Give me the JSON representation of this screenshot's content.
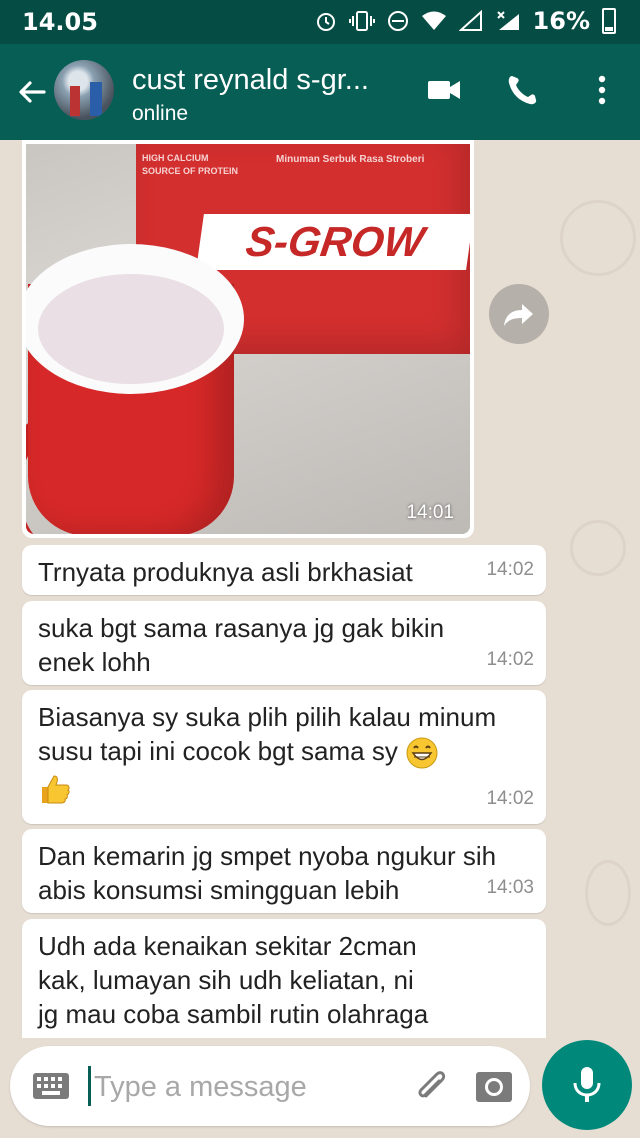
{
  "status_bar": {
    "time": "14.05",
    "battery": "16%",
    "icons": [
      "alarm-icon",
      "vibrate-icon",
      "do-not-disturb-icon",
      "wifi-icon",
      "signal-icon",
      "signal-x-icon",
      "battery-icon"
    ]
  },
  "header": {
    "contact_name": "cust reynald s-gr...",
    "status": "online",
    "icons": [
      "back-arrow-icon",
      "video-call-icon",
      "phone-icon",
      "more-vert-icon"
    ]
  },
  "messages": [
    {
      "type": "image",
      "time": "14:01",
      "image_text": {
        "badge": "HIGH CALCIUM\nSOURCE OF PROTEIN",
        "subtitle": "Minuman Serbuk Rasa Stroberi",
        "brand": "S-GROW"
      }
    },
    {
      "type": "text",
      "text": "Trnyata produknya asli brkhasiat",
      "time": "14:02"
    },
    {
      "type": "text",
      "text": "suka bgt sama rasanya jg gak bikin\nenek lohh",
      "time": "14:02"
    },
    {
      "type": "text",
      "text": "Biasanya sy suka plih pilih kalau minum\nsusu tapi ini cocok bgt sama sy",
      "emoji": [
        "grinning-face-icon",
        "thumbs-up-icon"
      ],
      "time": "14:02"
    },
    {
      "type": "text",
      "text": "Dan kemarin jg smpet nyoba ngukur sih\nabis konsumsi smingguan lebih",
      "time": "14:03"
    },
    {
      "type": "text",
      "text": "Udh ada kenaikan sekitar 2cman\nkak, lumayan sih udh keliatan, ni\njg mau coba sambil rutin olahraga",
      "time": ""
    }
  ],
  "composer": {
    "placeholder": "Type a message",
    "icons": [
      "keyboard-icon",
      "attach-icon",
      "camera-icon",
      "mic-icon"
    ]
  },
  "colors": {
    "header": "#075e54",
    "status_bar": "#054d44",
    "chat_background": "#e7ded3",
    "mic_button": "#00897b"
  }
}
